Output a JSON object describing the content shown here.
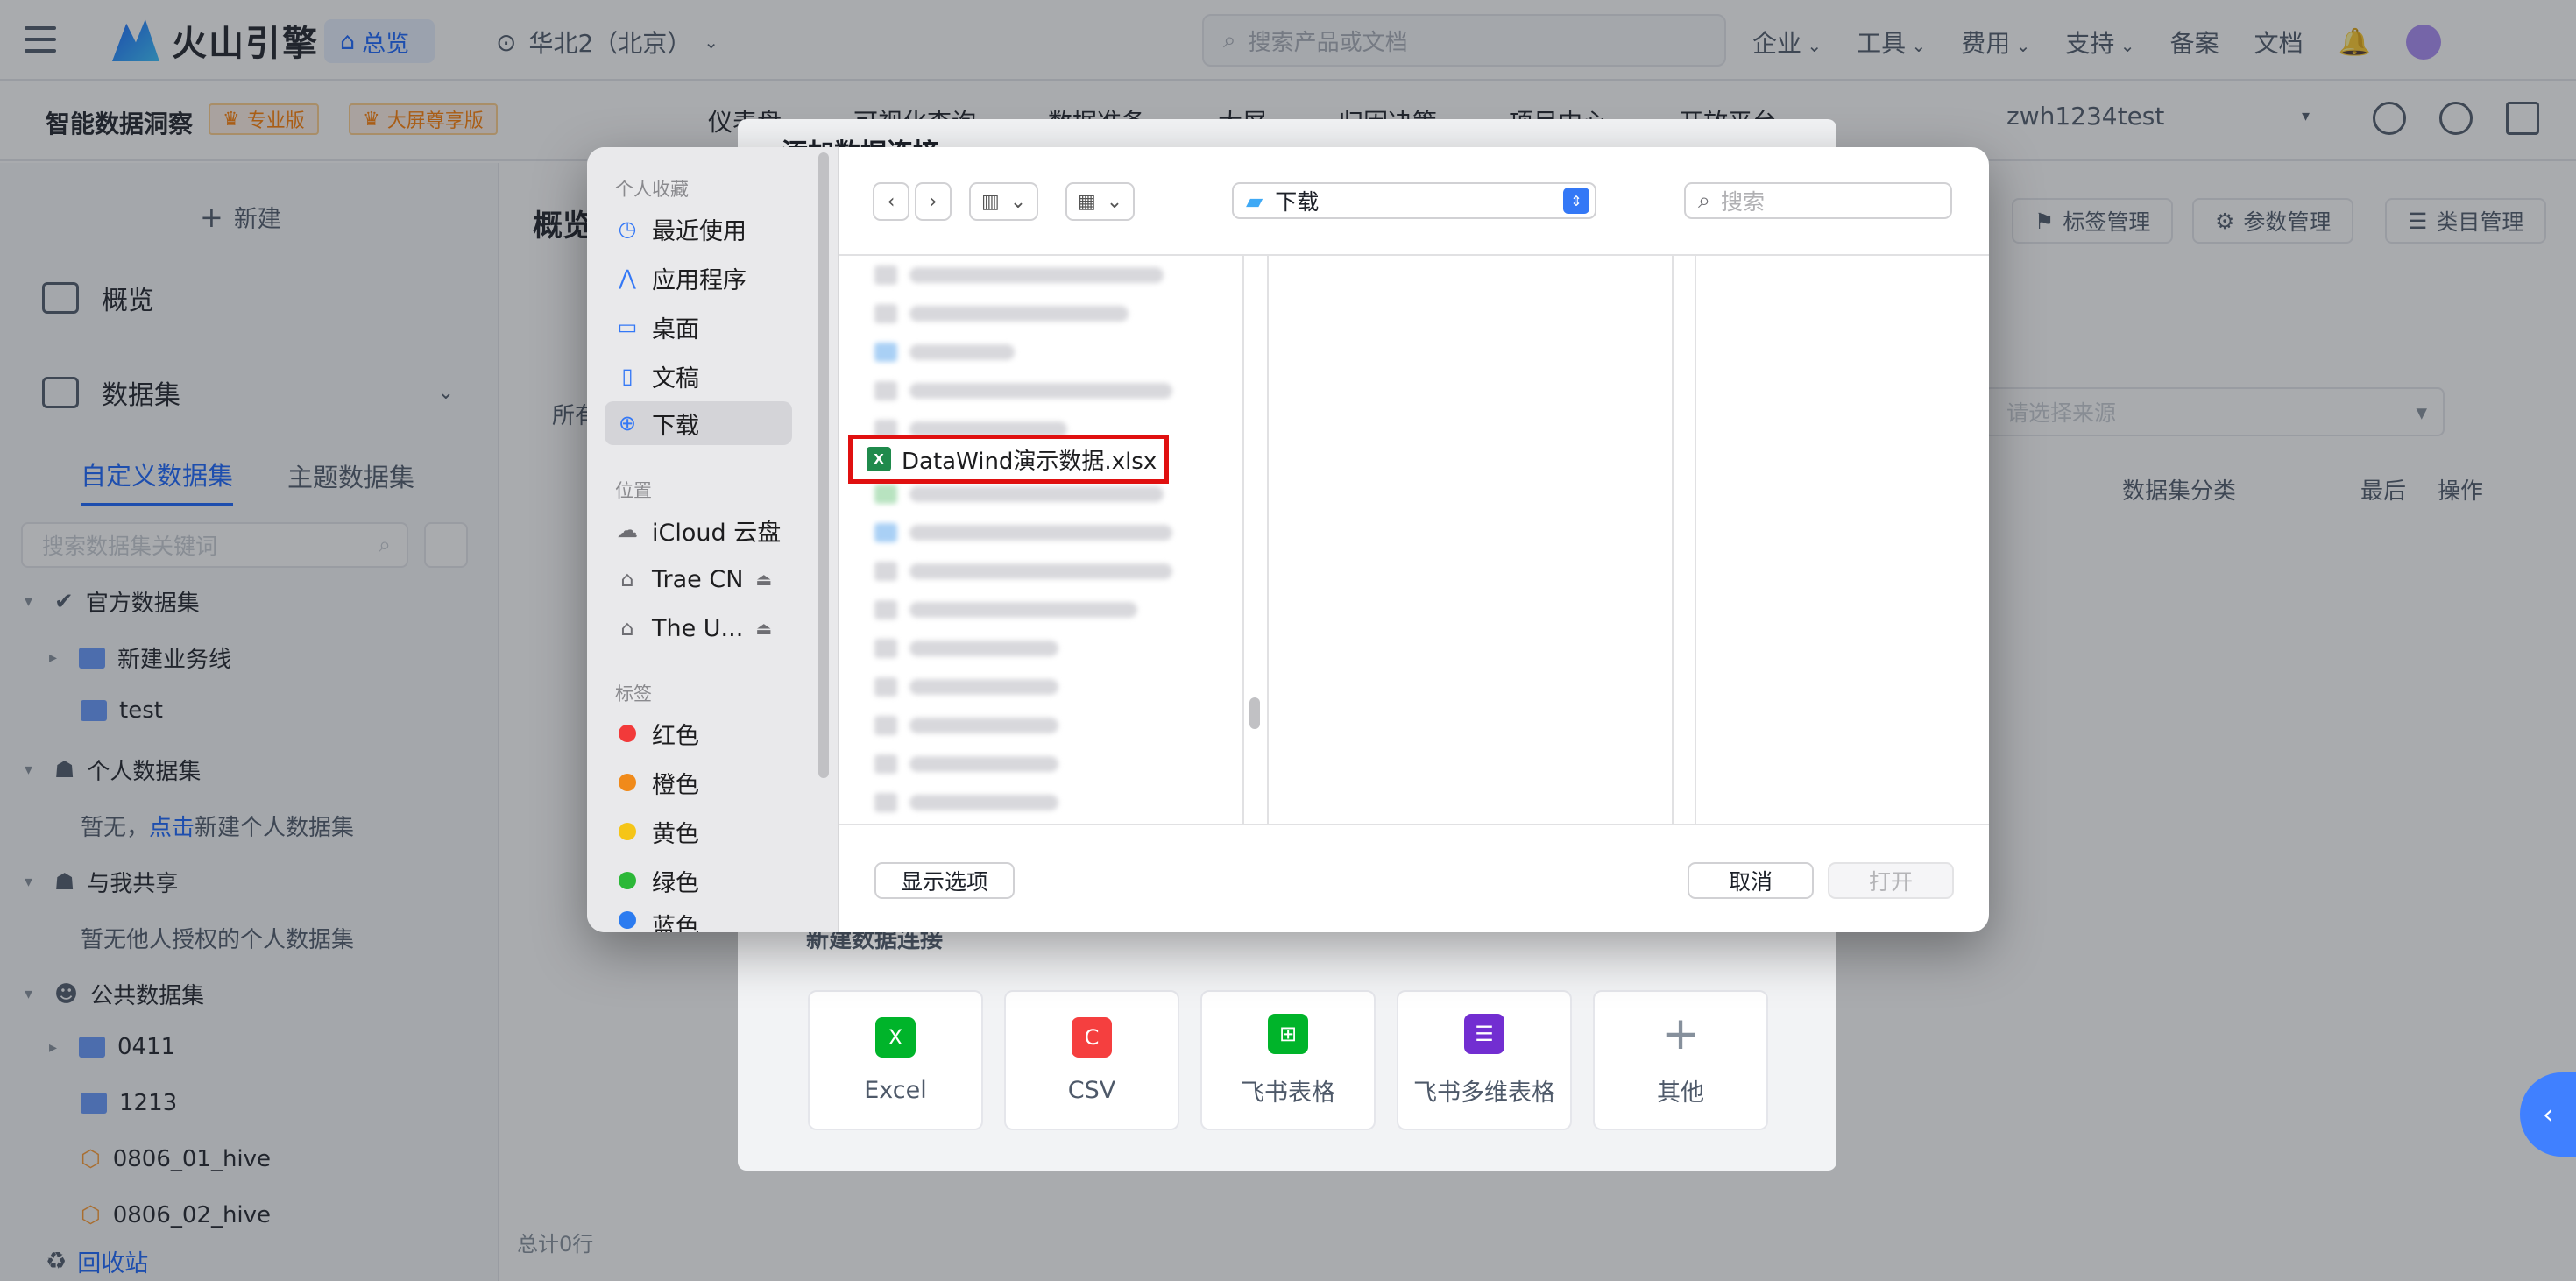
{
  "topbar": {
    "brand": "火山引擎",
    "home_label": "总览",
    "region": "华北2（北京）",
    "search_placeholder": "搜索产品或文档",
    "nav": [
      "企业",
      "工具",
      "费用",
      "支持",
      "备案",
      "文档"
    ]
  },
  "productbar": {
    "product_name": "智能数据洞察",
    "tag_pro": "专业版",
    "tag_bigscreen": "大屏尊享版",
    "nav": [
      "仪表盘",
      "可视化查询",
      "数据准备",
      "大屏",
      "归因决策",
      "项目中心",
      "开放平台"
    ],
    "account": "zwh1234test"
  },
  "sidebar": {
    "new_label": "新建",
    "menu": [
      {
        "label": "概览",
        "icon": "monitor-icon"
      },
      {
        "label": "数据集",
        "icon": "dataset-icon"
      }
    ],
    "tabs": [
      "自定义数据集",
      "主题数据集"
    ],
    "search_placeholder": "搜索数据集关键词",
    "tree": {
      "official": "官方数据集",
      "official_children": [
        "新建业务线",
        "test"
      ],
      "personal": "个人数据集",
      "personal_empty_prefix": "暂无，",
      "personal_empty_link": "点击",
      "personal_empty_suffix": "新建个人数据集",
      "shared": "与我共享",
      "shared_empty": "暂无他人授权的个人数据集",
      "public": "公共数据集",
      "public_children": [
        "0411",
        "1213",
        "0806_01_hive",
        "0806_02_hive"
      ]
    },
    "recycle": "回收站"
  },
  "main": {
    "title": "概览",
    "buttons": [
      "标签管理",
      "参数管理",
      "类目管理"
    ],
    "filter_all": "所有",
    "source_placeholder": "请选择来源",
    "columns": [
      "数据集分类",
      "最后",
      "操作"
    ],
    "total": "总计0行"
  },
  "modal": {
    "title": "添加数据连接",
    "connections_label": "新建数据连接",
    "cards": [
      {
        "label": "Excel",
        "color": "#00b42a",
        "glyph": "X"
      },
      {
        "label": "CSV",
        "color": "#f53f3f",
        "glyph": "C"
      },
      {
        "label": "飞书表格",
        "color": "#00b42a",
        "glyph": "⊞"
      },
      {
        "label": "飞书多维表格",
        "color": "#722ed1",
        "glyph": "☰"
      },
      {
        "label": "其他",
        "color": "",
        "glyph": "+"
      }
    ]
  },
  "file_dialog": {
    "favorites_label": "个人收藏",
    "favorites": [
      {
        "label": "最近使用",
        "icon": "clock-icon"
      },
      {
        "label": "应用程序",
        "icon": "apps-icon"
      },
      {
        "label": "桌面",
        "icon": "desktop-icon"
      },
      {
        "label": "文稿",
        "icon": "document-icon"
      },
      {
        "label": "下载",
        "icon": "download-icon"
      }
    ],
    "locations_label": "位置",
    "locations": [
      "iCloud 云盘",
      "Trae CN",
      "The U..."
    ],
    "tags_label": "标签",
    "tags": [
      {
        "label": "红色",
        "color": "#f23a3a"
      },
      {
        "label": "橙色",
        "color": "#f08a1a"
      },
      {
        "label": "黄色",
        "color": "#f5c518"
      },
      {
        "label": "绿色",
        "color": "#2cb838"
      },
      {
        "label": "蓝色",
        "color": "#2b7bf0"
      }
    ],
    "current_folder": "下载",
    "search_placeholder": "搜索",
    "highlighted_file": "DataWind演示数据.xlsx",
    "show_options": "显示选项",
    "cancel": "取消",
    "open": "打开"
  }
}
